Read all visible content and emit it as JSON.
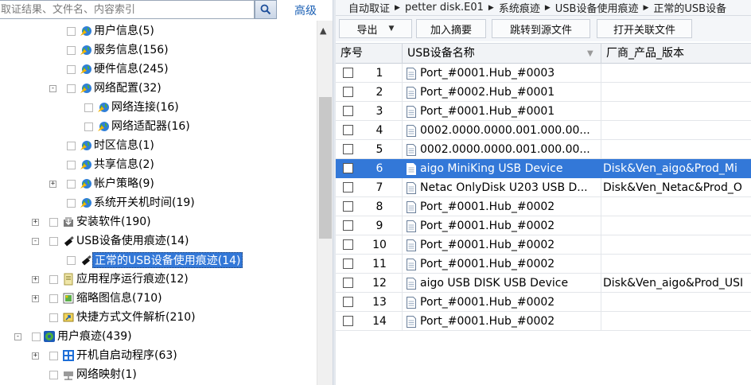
{
  "search": {
    "placeholder": "取证结果、文件名、内容索引",
    "advanced_label": "高级"
  },
  "tree": [
    {
      "label": "用户信息(5)",
      "icon": "globe-icon",
      "level": 3,
      "expander": "",
      "selected": false
    },
    {
      "label": "服务信息(156)",
      "icon": "globe-icon",
      "level": 3,
      "expander": "",
      "selected": false
    },
    {
      "label": "硬件信息(245)",
      "icon": "globe-icon",
      "level": 3,
      "expander": "",
      "selected": false
    },
    {
      "label": "网络配置(32)",
      "icon": "globe-icon",
      "level": 3,
      "expander": "-",
      "selected": false
    },
    {
      "label": "网络连接(16)",
      "icon": "globe-icon",
      "level": 4,
      "expander": "",
      "selected": false
    },
    {
      "label": "网络适配器(16)",
      "icon": "globe-icon",
      "level": 4,
      "expander": "",
      "selected": false
    },
    {
      "label": "时区信息(1)",
      "icon": "globe-icon",
      "level": 3,
      "expander": "",
      "selected": false
    },
    {
      "label": "共享信息(2)",
      "icon": "globe-icon",
      "level": 3,
      "expander": "",
      "selected": false
    },
    {
      "label": "帐户策略(9)",
      "icon": "globe-icon",
      "level": 3,
      "expander": "+",
      "selected": false
    },
    {
      "label": "系统开关机时间(19)",
      "icon": "globe-icon",
      "level": 3,
      "expander": "",
      "selected": false
    },
    {
      "label": "安装软件(190)",
      "icon": "install-icon",
      "level": 2,
      "expander": "+",
      "selected": false
    },
    {
      "label": "USB设备使用痕迹(14)",
      "icon": "usb-icon",
      "level": 2,
      "expander": "-",
      "selected": false
    },
    {
      "label": "正常的USB设备使用痕迹(14)",
      "icon": "usb-icon",
      "level": 3,
      "expander": "",
      "selected": true
    },
    {
      "label": "应用程序运行痕迹(12)",
      "icon": "app-run-icon",
      "level": 2,
      "expander": "+",
      "selected": false
    },
    {
      "label": "缩略图信息(710)",
      "icon": "thumbnail-icon",
      "level": 2,
      "expander": "+",
      "selected": false
    },
    {
      "label": "快捷方式文件解析(210)",
      "icon": "shortcut-icon",
      "level": 2,
      "expander": "",
      "selected": false
    },
    {
      "label": "用户痕迹(439)",
      "icon": "user-globe-icon",
      "level": 1,
      "expander": "-",
      "selected": false
    },
    {
      "label": "开机自启动程序(63)",
      "icon": "startup-icon",
      "level": 2,
      "expander": "+",
      "selected": false
    },
    {
      "label": "网络映射(1)",
      "icon": "network-drive-icon",
      "level": 2,
      "expander": "",
      "selected": false
    }
  ],
  "breadcrumb": [
    "自动取证",
    "petter disk.E01",
    "系统痕迹",
    "USB设备使用痕迹",
    "正常的USB设备"
  ],
  "toolbar": {
    "export_label": "导出",
    "add_summary_label": "加入摘要",
    "jump_source_label": "跳转到源文件",
    "open_related_label": "打开关联文件"
  },
  "grid": {
    "columns": [
      "序号",
      "USB设备名称",
      "厂商_产品_版本"
    ],
    "rows": [
      {
        "num": "1",
        "name": "Port_#0001.Hub_#0003",
        "vendor": ""
      },
      {
        "num": "2",
        "name": "Port_#0002.Hub_#0001",
        "vendor": ""
      },
      {
        "num": "3",
        "name": "Port_#0001.Hub_#0001",
        "vendor": ""
      },
      {
        "num": "4",
        "name": "0002.0000.0000.001.000.00...",
        "vendor": ""
      },
      {
        "num": "5",
        "name": "0002.0000.0000.001.000.00...",
        "vendor": ""
      },
      {
        "num": "6",
        "name": "aigo MiniKing USB Device",
        "vendor": "Disk&Ven_aigo&Prod_Mi",
        "selected": true
      },
      {
        "num": "7",
        "name": "Netac OnlyDisk U203 USB D...",
        "vendor": "Disk&Ven_Netac&Prod_O"
      },
      {
        "num": "8",
        "name": "Port_#0001.Hub_#0002",
        "vendor": ""
      },
      {
        "num": "9",
        "name": "Port_#0001.Hub_#0002",
        "vendor": ""
      },
      {
        "num": "10",
        "name": "Port_#0001.Hub_#0002",
        "vendor": ""
      },
      {
        "num": "11",
        "name": "Port_#0001.Hub_#0002",
        "vendor": ""
      },
      {
        "num": "12",
        "name": "aigo USB DISK USB Device",
        "vendor": "Disk&Ven_aigo&Prod_USI"
      },
      {
        "num": "13",
        "name": "Port_#0001.Hub_#0002",
        "vendor": ""
      },
      {
        "num": "14",
        "name": "Port_#0001.Hub_#0002",
        "vendor": ""
      }
    ]
  },
  "colors": {
    "selection": "#3378d8",
    "link": "#1a5fb4"
  }
}
